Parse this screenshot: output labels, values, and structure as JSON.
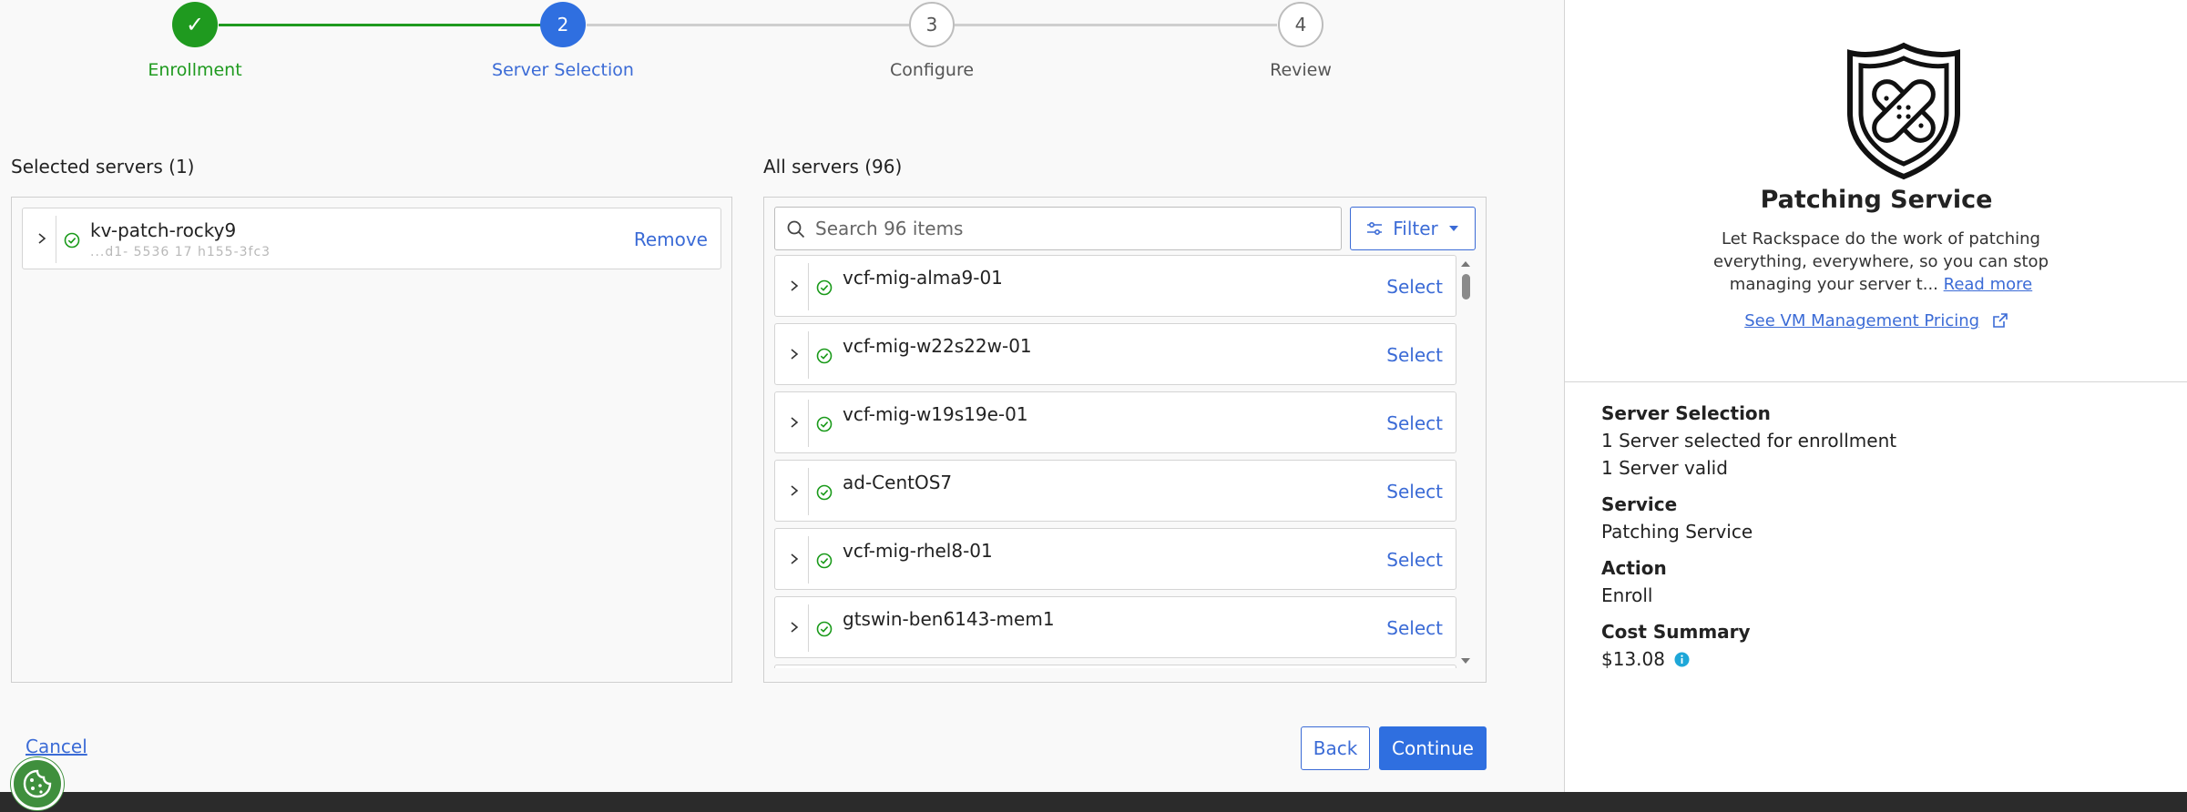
{
  "stepper": {
    "steps": [
      {
        "number": "✓",
        "label": "Enrollment",
        "state": "complete"
      },
      {
        "number": "2",
        "label": "Server Selection",
        "state": "active"
      },
      {
        "number": "3",
        "label": "Configure",
        "state": "pending"
      },
      {
        "number": "4",
        "label": "Review",
        "state": "pending"
      }
    ]
  },
  "selected": {
    "title": "Selected servers (1)",
    "items": [
      {
        "name": "kv-patch-rocky9",
        "sub": "...d1- 5536 17 h155-3fc3",
        "action": "Remove"
      }
    ]
  },
  "all": {
    "title": "All servers (96)",
    "search_placeholder": "Search 96 items",
    "filter_label": "Filter",
    "items": [
      {
        "name": "vcf-mig-alma9-01",
        "sub": "",
        "action": "Select"
      },
      {
        "name": "vcf-mig-w22s22w-01",
        "sub": "",
        "action": "Select"
      },
      {
        "name": "vcf-mig-w19s19e-01",
        "sub": "",
        "action": "Select"
      },
      {
        "name": "ad-CentOS7",
        "sub": "",
        "action": "Select"
      },
      {
        "name": "vcf-mig-rhel8-01",
        "sub": "",
        "action": "Select"
      },
      {
        "name": "gtswin-ben6143-mem1",
        "sub": "",
        "action": "Select"
      }
    ]
  },
  "actions": {
    "cancel": "Cancel",
    "back": "Back",
    "continue": "Continue"
  },
  "sidebar": {
    "service_title": "Patching Service",
    "description": "Let Rackspace do the work of patching everything, everywhere, so you can stop managing your server t...",
    "read_more": "Read more",
    "pricing_link": "See VM Management Pricing",
    "summary": {
      "server_selection_head": "Server Selection",
      "server_selection_line1": "1 Server selected for enrollment",
      "server_selection_line2": "1 Server valid",
      "service_head": "Service",
      "service_val": "Patching Service",
      "action_head": "Action",
      "action_val": "Enroll",
      "cost_head": "Cost Summary",
      "cost_val": "$13.08"
    }
  },
  "colors": {
    "accent": "#3b6bd6",
    "success": "#1a9a1a",
    "active_step": "#2f6fe0"
  }
}
